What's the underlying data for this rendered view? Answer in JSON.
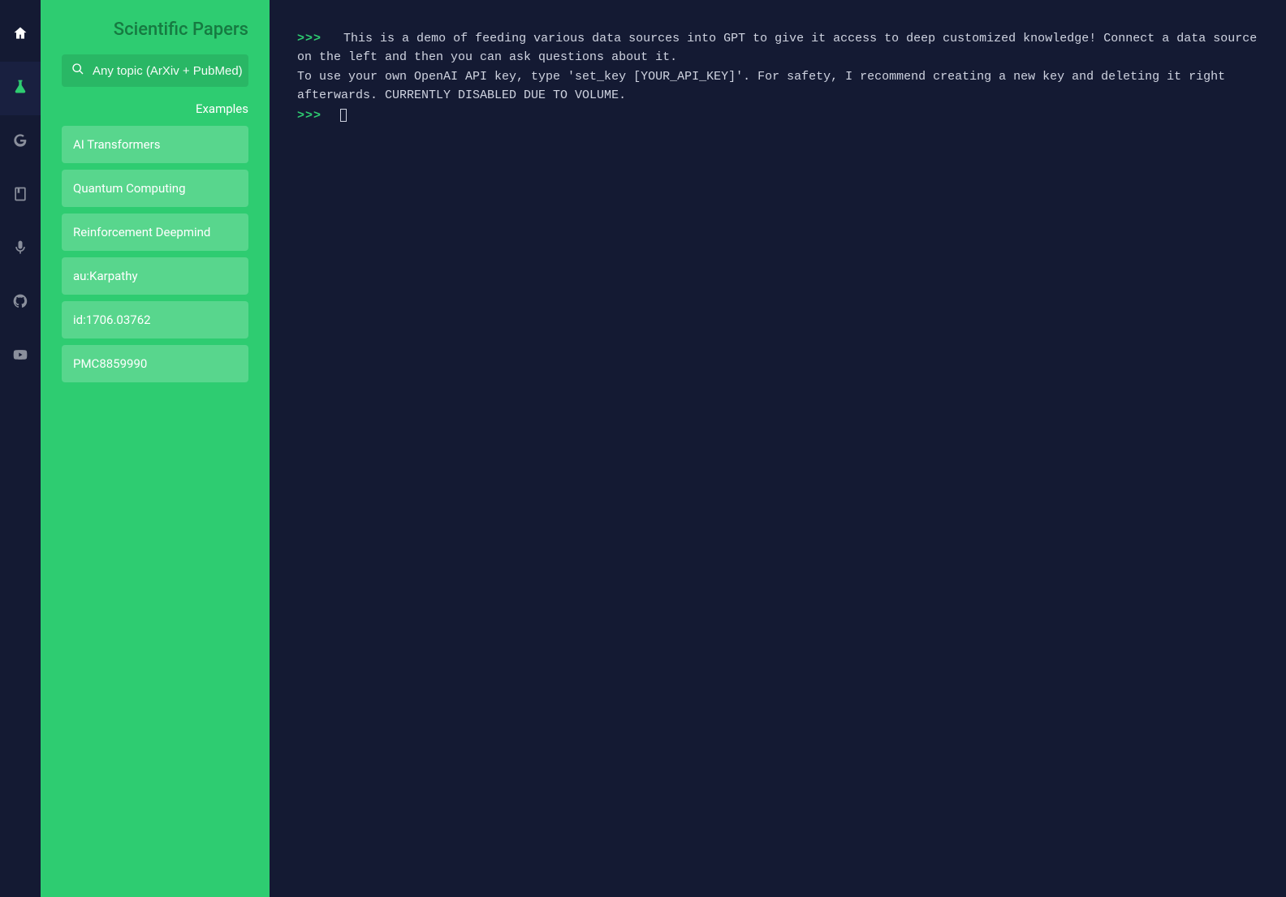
{
  "rail": {
    "items": [
      {
        "name": "home",
        "active": false
      },
      {
        "name": "flask",
        "active": true
      },
      {
        "name": "google",
        "active": false
      },
      {
        "name": "book",
        "active": false
      },
      {
        "name": "mic",
        "active": false
      },
      {
        "name": "github",
        "active": false
      },
      {
        "name": "youtube",
        "active": false
      }
    ]
  },
  "sidebar": {
    "title": "Scientific Papers",
    "search": {
      "placeholder": "Any topic (ArXiv + PubMed)",
      "value": ""
    },
    "examples_label": "Examples",
    "examples": [
      "AI Transformers",
      "Quantum Computing",
      "Reinforcement Deepmind",
      "au:Karpathy",
      "id:1706.03762",
      "PMC8859990"
    ]
  },
  "console": {
    "prompt": ">>>",
    "intro": "This is a demo of feeding various data sources into GPT to give it access to deep customized knowledge! Connect a data source on the left and then you can ask questions about it.\nTo use your own OpenAI API key, type 'set_key [YOUR_API_KEY]'. For safety, I recommend creating a new key and deleting it right afterwards. CURRENTLY DISABLED DUE TO VOLUME."
  }
}
